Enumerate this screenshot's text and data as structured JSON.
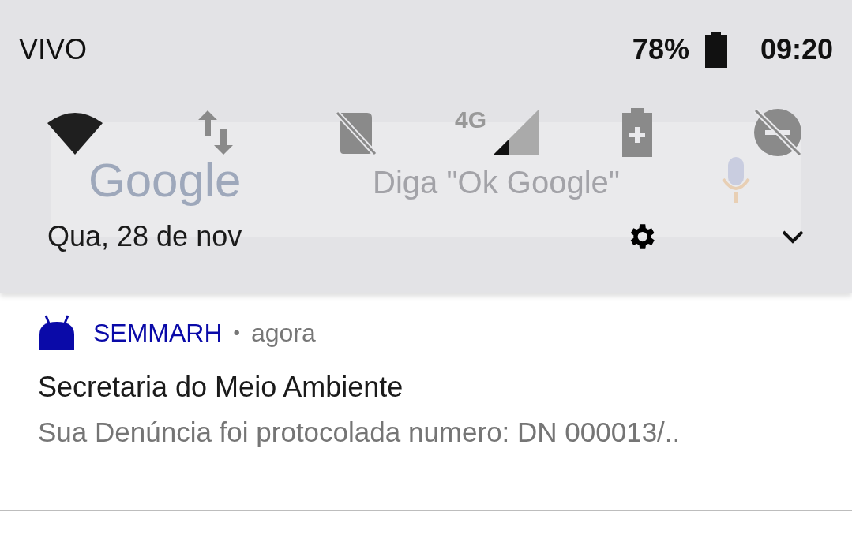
{
  "status_bar": {
    "carrier": "VIVO",
    "battery": "78%",
    "time": "09:20"
  },
  "quick_tiles": [
    {
      "kind": "wifi",
      "on": true
    },
    {
      "kind": "data",
      "on": false
    },
    {
      "kind": "sim",
      "on": false
    },
    {
      "kind": "signal",
      "on": false,
      "label": "4G"
    },
    {
      "kind": "battery_saver",
      "on": false
    },
    {
      "kind": "dnd",
      "on": false
    }
  ],
  "search_widget": {
    "logo": "Google",
    "placeholder": "Diga \"Ok Google\""
  },
  "date": "Qua, 28 de nov",
  "notification": {
    "app": "SEMMARH",
    "separator": "•",
    "time": "agora",
    "title": "Secretaria do Meio Ambiente",
    "text": "Sua Denúncia foi protocolada numero: DN 000013/.."
  }
}
